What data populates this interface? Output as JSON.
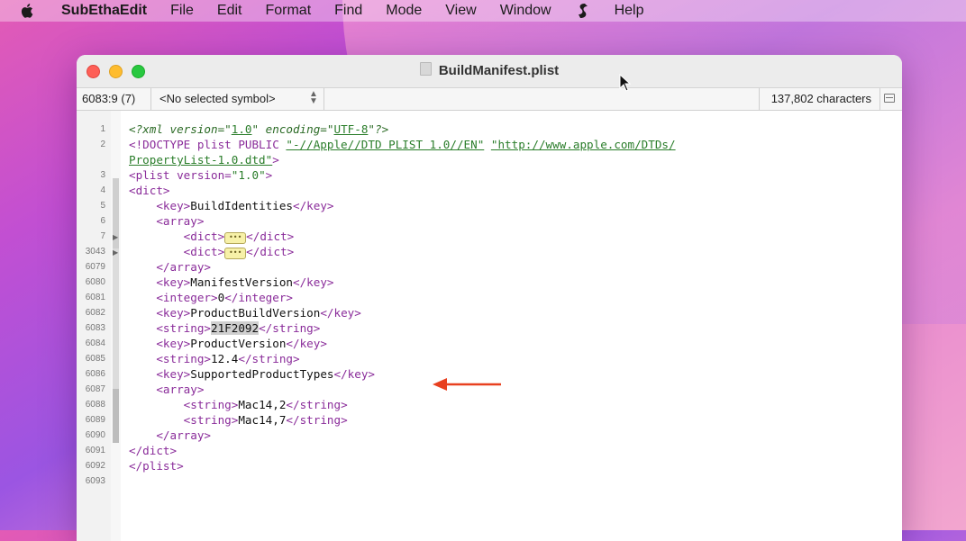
{
  "menubar": {
    "app_name": "SubEthaEdit",
    "items": [
      "File",
      "Edit",
      "Format",
      "Find",
      "Mode",
      "View",
      "Window",
      "Help"
    ]
  },
  "window": {
    "title": "BuildManifest.plist",
    "toolbar": {
      "position": "6083:9 (7)",
      "symbol": "<No selected symbol>",
      "characters": "137,802 characters"
    }
  },
  "editor": {
    "lines": [
      {
        "n": "1",
        "indent": "",
        "tokens": [
          [
            "pi",
            "<?xml version=\""
          ],
          [
            "ustr",
            "1.0"
          ],
          [
            "pi",
            "\" encoding=\""
          ],
          [
            "ustr",
            "UTF-8"
          ],
          [
            "pi",
            "\"?>"
          ]
        ]
      },
      {
        "n": "2",
        "indent": "",
        "tokens": [
          [
            "tag",
            "<!DOCTYPE plist PUBLIC "
          ],
          [
            "ustr",
            "\"-//Apple//DTD PLIST 1.0//EN\""
          ],
          [
            "plain",
            " "
          ],
          [
            "ustr",
            "\"http://www.apple.com/DTDs/"
          ]
        ]
      },
      {
        "n": "",
        "indent": "",
        "tokens": [
          [
            "ustr",
            "PropertyList-1.0.dtd\""
          ],
          [
            "tag",
            ">"
          ]
        ]
      },
      {
        "n": "3",
        "indent": "",
        "tokens": [
          [
            "tag",
            "<plist "
          ],
          [
            "attr",
            "version="
          ],
          [
            "str",
            "\"1.0\""
          ],
          [
            "tag",
            ">"
          ]
        ]
      },
      {
        "n": "4",
        "indent": "",
        "tokens": [
          [
            "tag",
            "<dict>"
          ]
        ]
      },
      {
        "n": "5",
        "indent": "    ",
        "tokens": [
          [
            "tag",
            "<key>"
          ],
          [
            "plain",
            "BuildIdentities"
          ],
          [
            "tag",
            "</key>"
          ]
        ]
      },
      {
        "n": "6",
        "indent": "    ",
        "tokens": [
          [
            "tag",
            "<array>"
          ]
        ]
      },
      {
        "n": "7",
        "indent": "        ",
        "tokens": [
          [
            "tag",
            "<dict>"
          ],
          [
            "badge",
            "•••"
          ],
          [
            "tag",
            "</dict>"
          ]
        ]
      },
      {
        "n": "3043",
        "indent": "        ",
        "tokens": [
          [
            "tag",
            "<dict>"
          ],
          [
            "badge",
            "•••"
          ],
          [
            "tag",
            "</dict>"
          ]
        ]
      },
      {
        "n": "6079",
        "indent": "    ",
        "tokens": [
          [
            "tag",
            "</array>"
          ]
        ]
      },
      {
        "n": "6080",
        "indent": "    ",
        "tokens": [
          [
            "tag",
            "<key>"
          ],
          [
            "plain",
            "ManifestVersion"
          ],
          [
            "tag",
            "</key>"
          ]
        ]
      },
      {
        "n": "6081",
        "indent": "    ",
        "tokens": [
          [
            "tag",
            "<integer>"
          ],
          [
            "plain",
            "0"
          ],
          [
            "tag",
            "</integer>"
          ]
        ]
      },
      {
        "n": "6082",
        "indent": "    ",
        "tokens": [
          [
            "tag",
            "<key>"
          ],
          [
            "plain",
            "ProductBuildVersion"
          ],
          [
            "tag",
            "</key>"
          ]
        ]
      },
      {
        "n": "6083",
        "indent": "    ",
        "tokens": [
          [
            "tag",
            "<string>"
          ],
          [
            "sel",
            "21F2092"
          ],
          [
            "tag",
            "</string>"
          ]
        ]
      },
      {
        "n": "6084",
        "indent": "    ",
        "tokens": [
          [
            "tag",
            "<key>"
          ],
          [
            "plain",
            "ProductVersion"
          ],
          [
            "tag",
            "</key>"
          ]
        ]
      },
      {
        "n": "6085",
        "indent": "    ",
        "tokens": [
          [
            "tag",
            "<string>"
          ],
          [
            "plain",
            "12.4"
          ],
          [
            "tag",
            "</string>"
          ]
        ]
      },
      {
        "n": "6086",
        "indent": "    ",
        "tokens": [
          [
            "tag",
            "<key>"
          ],
          [
            "plain",
            "SupportedProductTypes"
          ],
          [
            "tag",
            "</key>"
          ]
        ]
      },
      {
        "n": "6087",
        "indent": "    ",
        "tokens": [
          [
            "tag",
            "<array>"
          ]
        ]
      },
      {
        "n": "6088",
        "indent": "        ",
        "tokens": [
          [
            "tag",
            "<string>"
          ],
          [
            "plain",
            "Mac14,2"
          ],
          [
            "tag",
            "</string>"
          ]
        ]
      },
      {
        "n": "6089",
        "indent": "        ",
        "tokens": [
          [
            "tag",
            "<string>"
          ],
          [
            "plain",
            "Mac14,7"
          ],
          [
            "tag",
            "</string>"
          ]
        ]
      },
      {
        "n": "6090",
        "indent": "    ",
        "tokens": [
          [
            "tag",
            "</array>"
          ]
        ]
      },
      {
        "n": "6091",
        "indent": "",
        "tokens": [
          [
            "tag",
            "</dict>"
          ]
        ]
      },
      {
        "n": "6092",
        "indent": "",
        "tokens": [
          [
            "tag",
            "</plist>"
          ]
        ]
      },
      {
        "n": "6093",
        "indent": "",
        "tokens": []
      }
    ]
  },
  "colors": {
    "annotation_arrow": "#e8401f",
    "tag": "#8a2c9a",
    "string": "#2a7d2a"
  },
  "icons": [
    "apple-icon",
    "script-menu-icon",
    "document-icon",
    "split-view-icon",
    "mouse-pointer-icon",
    "red-arrow-icon"
  ]
}
